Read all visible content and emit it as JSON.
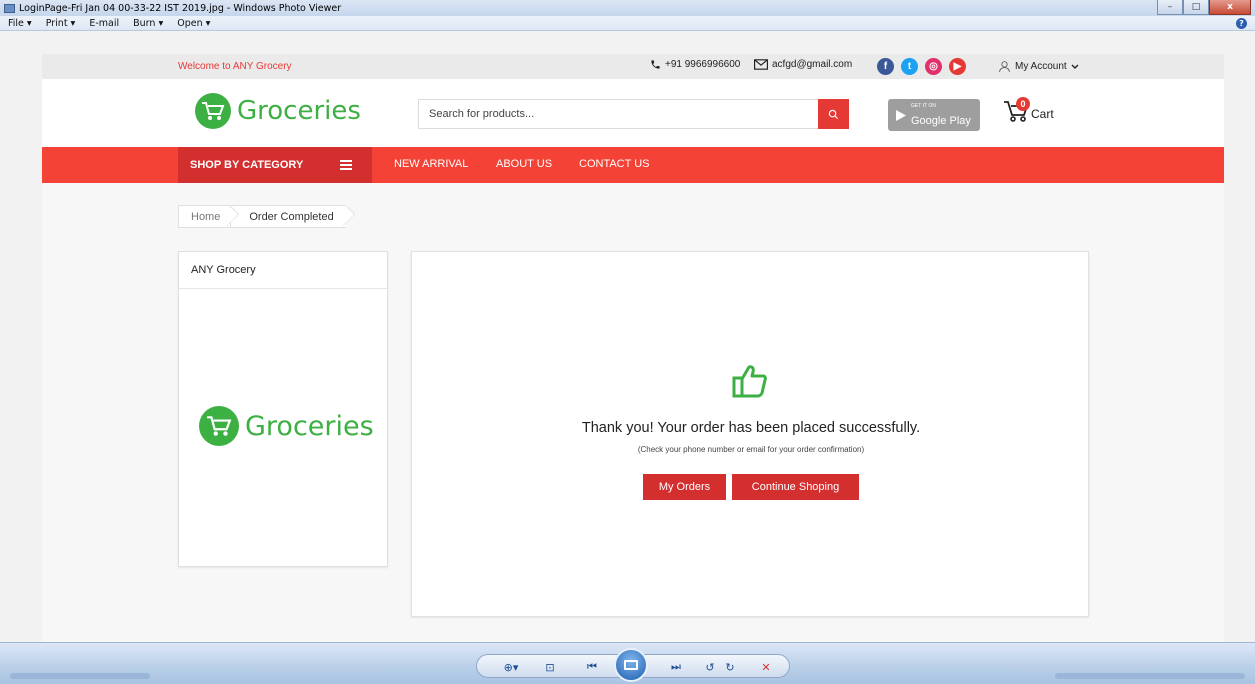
{
  "window": {
    "title": "LoginPage-Fri Jan 04 00-33-22 IST 2019.jpg - Windows Photo Viewer",
    "minimize": "–",
    "maximize": "□",
    "close": "x"
  },
  "menu": {
    "items": [
      "File ▾",
      "Print ▾",
      "E-mail",
      "Burn ▾",
      "Open ▾"
    ],
    "help": "?"
  },
  "topbar": {
    "welcome": "Welcome to ANY Grocery",
    "phone": "+91 9966996600",
    "email": "acfgd@gmail.com",
    "social_icons": [
      "facebook-icon",
      "twitter-icon",
      "instagram-icon",
      "youtube-icon"
    ],
    "social_glyphs": [
      "f",
      "t",
      "◎",
      "▶"
    ],
    "social_colors": [
      "#3b5998",
      "#1da1f2",
      "#e1306c",
      "#e53935"
    ],
    "account": "My Account"
  },
  "header": {
    "logo_text": "Groceries",
    "search_placeholder": "Search for products...",
    "gplay_small": "GET IT ON",
    "gplay_big": "Google Play",
    "cart_count": "0",
    "cart_label": "Cart"
  },
  "nav": {
    "category": "SHOP BY CATEGORY",
    "links": [
      "NEW ARRIVAL",
      "ABOUT US",
      "CONTACT US"
    ]
  },
  "breadcrumb": [
    "Home",
    "Order Completed"
  ],
  "sidebar": {
    "title": "ANY Grocery",
    "logo_text": "Groceries"
  },
  "order": {
    "message": "Thank you! Your order has been placed successfully.",
    "submessage": "(Check your phone number or email for your order confirmation)",
    "my_orders": "My Orders",
    "continue": "Continue Shoping"
  },
  "colors": {
    "brand_red": "#f44336",
    "dark_red": "#d32f2f",
    "brand_green": "#3db043"
  }
}
